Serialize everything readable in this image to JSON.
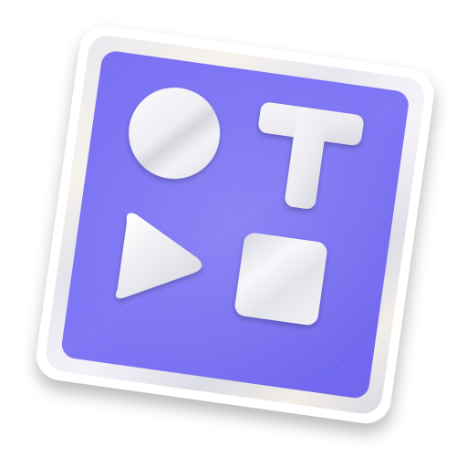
{
  "app_icon": {
    "icon_name": "shapes-app-icon",
    "shapes": [
      "circle-icon",
      "letter-t-icon",
      "play-triangle-icon",
      "square-icon"
    ],
    "colors": {
      "background": "#ffffff",
      "frame_outer": "#ffffff",
      "frame_silver": "#d9dae3",
      "tile_purple": "#7b72f2",
      "tile_purple_dark": "#6d63ea",
      "glyph_light": "#f4f4f8",
      "glyph_shade": "#c9cad3"
    }
  }
}
